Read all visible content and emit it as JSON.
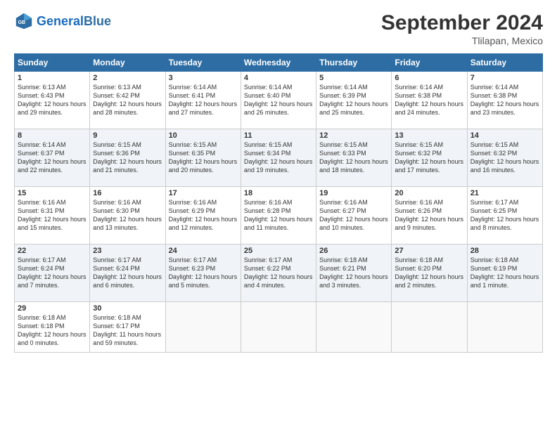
{
  "header": {
    "logo_general": "General",
    "logo_blue": "Blue",
    "title": "September 2024",
    "subtitle": "Tlilapan, Mexico"
  },
  "weekdays": [
    "Sunday",
    "Monday",
    "Tuesday",
    "Wednesday",
    "Thursday",
    "Friday",
    "Saturday"
  ],
  "weeks": [
    [
      {
        "day": "1",
        "sunrise": "6:13 AM",
        "sunset": "6:43 PM",
        "daylight": "12 hours and 29 minutes."
      },
      {
        "day": "2",
        "sunrise": "6:13 AM",
        "sunset": "6:42 PM",
        "daylight": "12 hours and 28 minutes."
      },
      {
        "day": "3",
        "sunrise": "6:14 AM",
        "sunset": "6:41 PM",
        "daylight": "12 hours and 27 minutes."
      },
      {
        "day": "4",
        "sunrise": "6:14 AM",
        "sunset": "6:40 PM",
        "daylight": "12 hours and 26 minutes."
      },
      {
        "day": "5",
        "sunrise": "6:14 AM",
        "sunset": "6:39 PM",
        "daylight": "12 hours and 25 minutes."
      },
      {
        "day": "6",
        "sunrise": "6:14 AM",
        "sunset": "6:38 PM",
        "daylight": "12 hours and 24 minutes."
      },
      {
        "day": "7",
        "sunrise": "6:14 AM",
        "sunset": "6:38 PM",
        "daylight": "12 hours and 23 minutes."
      }
    ],
    [
      {
        "day": "8",
        "sunrise": "6:14 AM",
        "sunset": "6:37 PM",
        "daylight": "12 hours and 22 minutes."
      },
      {
        "day": "9",
        "sunrise": "6:15 AM",
        "sunset": "6:36 PM",
        "daylight": "12 hours and 21 minutes."
      },
      {
        "day": "10",
        "sunrise": "6:15 AM",
        "sunset": "6:35 PM",
        "daylight": "12 hours and 20 minutes."
      },
      {
        "day": "11",
        "sunrise": "6:15 AM",
        "sunset": "6:34 PM",
        "daylight": "12 hours and 19 minutes."
      },
      {
        "day": "12",
        "sunrise": "6:15 AM",
        "sunset": "6:33 PM",
        "daylight": "12 hours and 18 minutes."
      },
      {
        "day": "13",
        "sunrise": "6:15 AM",
        "sunset": "6:32 PM",
        "daylight": "12 hours and 17 minutes."
      },
      {
        "day": "14",
        "sunrise": "6:15 AM",
        "sunset": "6:32 PM",
        "daylight": "12 hours and 16 minutes."
      }
    ],
    [
      {
        "day": "15",
        "sunrise": "6:16 AM",
        "sunset": "6:31 PM",
        "daylight": "12 hours and 15 minutes."
      },
      {
        "day": "16",
        "sunrise": "6:16 AM",
        "sunset": "6:30 PM",
        "daylight": "12 hours and 13 minutes."
      },
      {
        "day": "17",
        "sunrise": "6:16 AM",
        "sunset": "6:29 PM",
        "daylight": "12 hours and 12 minutes."
      },
      {
        "day": "18",
        "sunrise": "6:16 AM",
        "sunset": "6:28 PM",
        "daylight": "12 hours and 11 minutes."
      },
      {
        "day": "19",
        "sunrise": "6:16 AM",
        "sunset": "6:27 PM",
        "daylight": "12 hours and 10 minutes."
      },
      {
        "day": "20",
        "sunrise": "6:16 AM",
        "sunset": "6:26 PM",
        "daylight": "12 hours and 9 minutes."
      },
      {
        "day": "21",
        "sunrise": "6:17 AM",
        "sunset": "6:25 PM",
        "daylight": "12 hours and 8 minutes."
      }
    ],
    [
      {
        "day": "22",
        "sunrise": "6:17 AM",
        "sunset": "6:24 PM",
        "daylight": "12 hours and 7 minutes."
      },
      {
        "day": "23",
        "sunrise": "6:17 AM",
        "sunset": "6:24 PM",
        "daylight": "12 hours and 6 minutes."
      },
      {
        "day": "24",
        "sunrise": "6:17 AM",
        "sunset": "6:23 PM",
        "daylight": "12 hours and 5 minutes."
      },
      {
        "day": "25",
        "sunrise": "6:17 AM",
        "sunset": "6:22 PM",
        "daylight": "12 hours and 4 minutes."
      },
      {
        "day": "26",
        "sunrise": "6:18 AM",
        "sunset": "6:21 PM",
        "daylight": "12 hours and 3 minutes."
      },
      {
        "day": "27",
        "sunrise": "6:18 AM",
        "sunset": "6:20 PM",
        "daylight": "12 hours and 2 minutes."
      },
      {
        "day": "28",
        "sunrise": "6:18 AM",
        "sunset": "6:19 PM",
        "daylight": "12 hours and 1 minute."
      }
    ],
    [
      {
        "day": "29",
        "sunrise": "6:18 AM",
        "sunset": "6:18 PM",
        "daylight": "12 hours and 0 minutes."
      },
      {
        "day": "30",
        "sunrise": "6:18 AM",
        "sunset": "6:17 PM",
        "daylight": "11 hours and 59 minutes."
      },
      null,
      null,
      null,
      null,
      null
    ]
  ]
}
